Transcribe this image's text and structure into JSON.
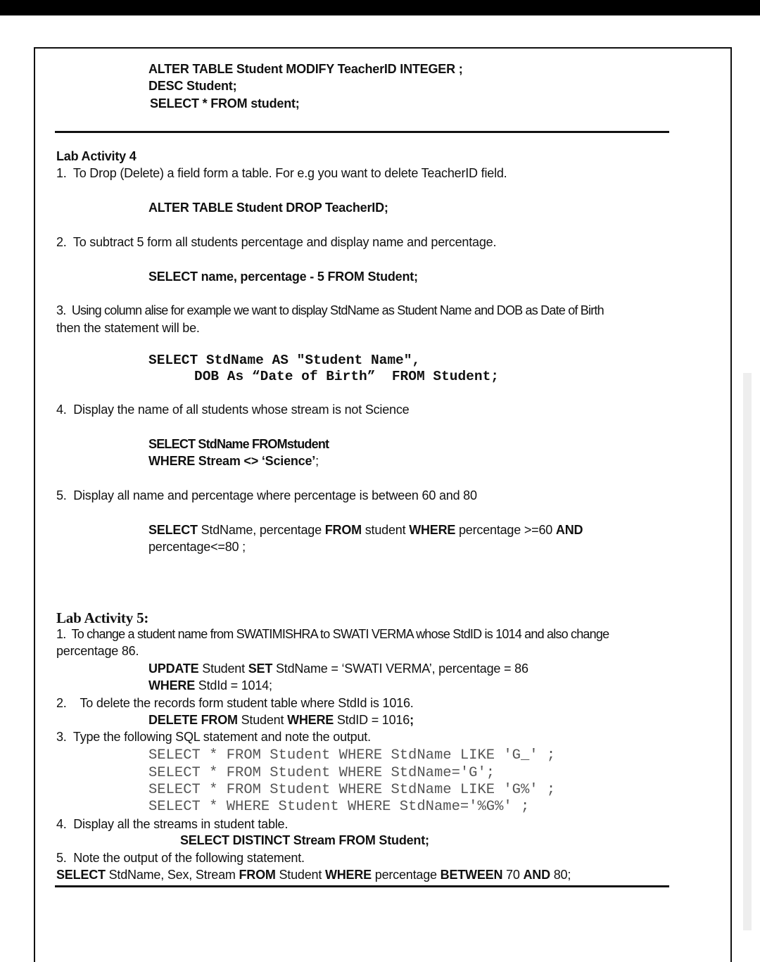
{
  "document": {
    "lines": [
      [
        {
          "t": "ALTER TABLE Student MODIFY TeacherID INTEGER ;",
          "b": true
        }
      ],
      [
        {
          "t": "DESC Student;",
          "b": true
        }
      ],
      [
        {
          "t": "SELECT * FROM student;",
          "b": true
        }
      ],
      [
        {
          "t": "Lab Activity 4",
          "b": true
        }
      ],
      [
        {
          "t": "1.  To Drop (Delete) a field form a table. For e.g you want to delete TeacherID field."
        }
      ],
      [
        {
          "t": "ALTER TABLE Student DROP TeacherID;",
          "b": true
        }
      ],
      [
        {
          "t": "2.  To subtract 5 form all students percentage and display name and percentage."
        }
      ],
      [
        {
          "t": "SELECT name, percentage - 5 FROM Student;",
          "b": true
        }
      ],
      [
        {
          "t": "3.  Using column alise for example we want to display StdName as Student Name and DOB as Date of Birth"
        }
      ],
      [
        {
          "t": "then the statement will be."
        }
      ],
      [
        {
          "t": "SELECT StdName AS \"Student Name\","
        }
      ],
      [
        {
          "t": "DOB As “Date of Birth”  FROM Student;"
        }
      ],
      [
        {
          "t": "4.  Display the name of all students whose stream is not Science"
        }
      ],
      [
        {
          "t": "SELECT StdName FROMstudent",
          "b": true
        }
      ],
      [
        {
          "t": "WHERE Stream <> ‘Science’",
          "b": true
        },
        {
          "t": ";"
        }
      ],
      [
        {
          "t": "5.  Display all name and percentage where percentage is between 60 and 80"
        }
      ],
      [
        {
          "t": "SELECT",
          "b": true
        },
        {
          "t": " StdName, percentage "
        },
        {
          "t": "FROM",
          "b": true
        },
        {
          "t": " student "
        },
        {
          "t": "WHERE",
          "b": true
        },
        {
          "t": " percentage >=60 "
        },
        {
          "t": "AND",
          "b": true
        }
      ],
      [
        {
          "t": "percentage<=80 ;"
        }
      ],
      [
        {
          "t": "Lab Activity 5:"
        }
      ],
      [
        {
          "t": "1.  To change a student name from SWATIMISHRA to SWATI VERMA whose StdID is 1014 and also change"
        }
      ],
      [
        {
          "t": "percentage 86."
        }
      ],
      [
        {
          "t": "UPDATE",
          "b": true
        },
        {
          "t": " Student "
        },
        {
          "t": "SET",
          "b": true
        },
        {
          "t": " StdName = ‘SWATI VERMA’, percentage = 86"
        }
      ],
      [
        {
          "t": "WHERE",
          "b": true
        },
        {
          "t": " StdId = 1014;"
        }
      ],
      [
        {
          "t": "2.    To delete the records form student table where StdId is 1016."
        }
      ],
      [
        {
          "t": "DELETE FROM",
          "b": true
        },
        {
          "t": " Student "
        },
        {
          "t": "WHERE",
          "b": true
        },
        {
          "t": " StdID = 1016"
        },
        {
          "t": ";",
          "b": true
        }
      ],
      [
        {
          "t": "3.  Type the following SQL statement and note the output."
        }
      ],
      [
        {
          "t": "SELECT * FROM Student WHERE StdName LIKE 'G_' ;"
        }
      ],
      [
        {
          "t": "SELECT * FROM Student WHERE StdName='G';"
        }
      ],
      [
        {
          "t": "SELECT * FROM Student WHERE StdName LIKE 'G%' ;"
        }
      ],
      [
        {
          "t": "SELECT * WHERE Student WHERE StdName='%G%' ;"
        }
      ],
      [
        {
          "t": "4.  Display all the streams in student table."
        }
      ],
      [
        {
          "t": "SELECT DISTINCT Stream FROM Student;",
          "b": true
        }
      ],
      [
        {
          "t": "5.  Note the output of the following statement."
        }
      ],
      [
        {
          "t": "SELECT",
          "b": true
        },
        {
          "t": " StdName, Sex, Stream "
        },
        {
          "t": "FROM",
          "b": true
        },
        {
          "t": " Student "
        },
        {
          "t": "WHERE",
          "b": true
        },
        {
          "t": " percentage "
        },
        {
          "t": "BETWEEN",
          "b": true
        },
        {
          "t": " 70 "
        },
        {
          "t": "AND",
          "b": true
        },
        {
          "t": " 80;"
        }
      ]
    ]
  }
}
